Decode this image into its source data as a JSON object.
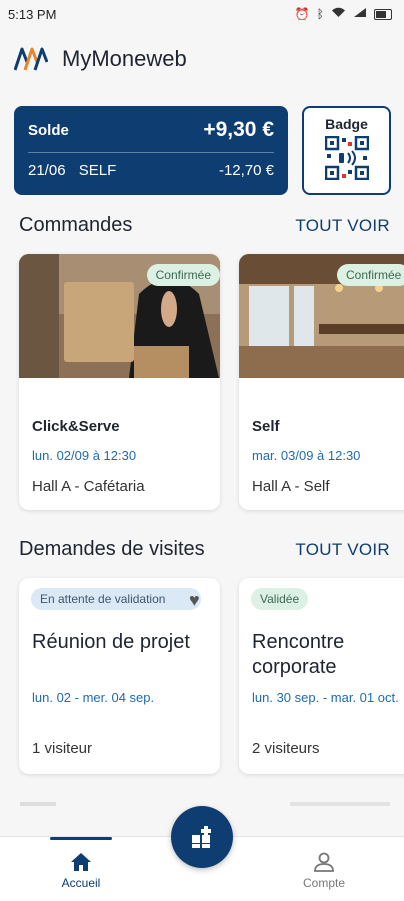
{
  "status_bar": {
    "time": "5:13 PM",
    "icons": [
      "alarm-icon",
      "bluetooth-icon",
      "wifi-icon",
      "signal-icon",
      "battery-icon"
    ]
  },
  "app": {
    "title": "MyMoneweb"
  },
  "balance": {
    "label": "Solde",
    "amount": "+9,30 €",
    "last_tx_date": "21/06",
    "last_tx_label": "SELF",
    "last_tx_amount": "-12,70 €"
  },
  "badge": {
    "label": "Badge"
  },
  "orders": {
    "title": "Commandes",
    "see_all": "TOUT VOIR",
    "items": [
      {
        "status": "Confirmée",
        "name": "Click&Serve",
        "date": "lun. 02/09 à 12:30",
        "place": "Hall A - Cafétaria"
      },
      {
        "status": "Confirmée",
        "name": "Self",
        "date": "mar. 03/09 à 12:30",
        "place": "Hall A - Self"
      }
    ]
  },
  "visits": {
    "title": "Demandes de visites",
    "see_all": "TOUT VOIR",
    "items": [
      {
        "status": "En attente de validation",
        "title": "Réunion de projet",
        "date": "lun. 02 - mer. 04 sep.",
        "count": "1 visiteur"
      },
      {
        "status": "Validée",
        "title": "Rencontre corporate",
        "date": "lun. 30 sep. - mar. 01 oct.",
        "count": "2 visiteurs"
      }
    ]
  },
  "nav": {
    "home": "Accueil",
    "account": "Compte"
  },
  "colors": {
    "primary": "#0e3d72",
    "link": "#1f6ab0",
    "pill_green": "#dcf0e4",
    "pill_blue": "#dbe8f5"
  }
}
